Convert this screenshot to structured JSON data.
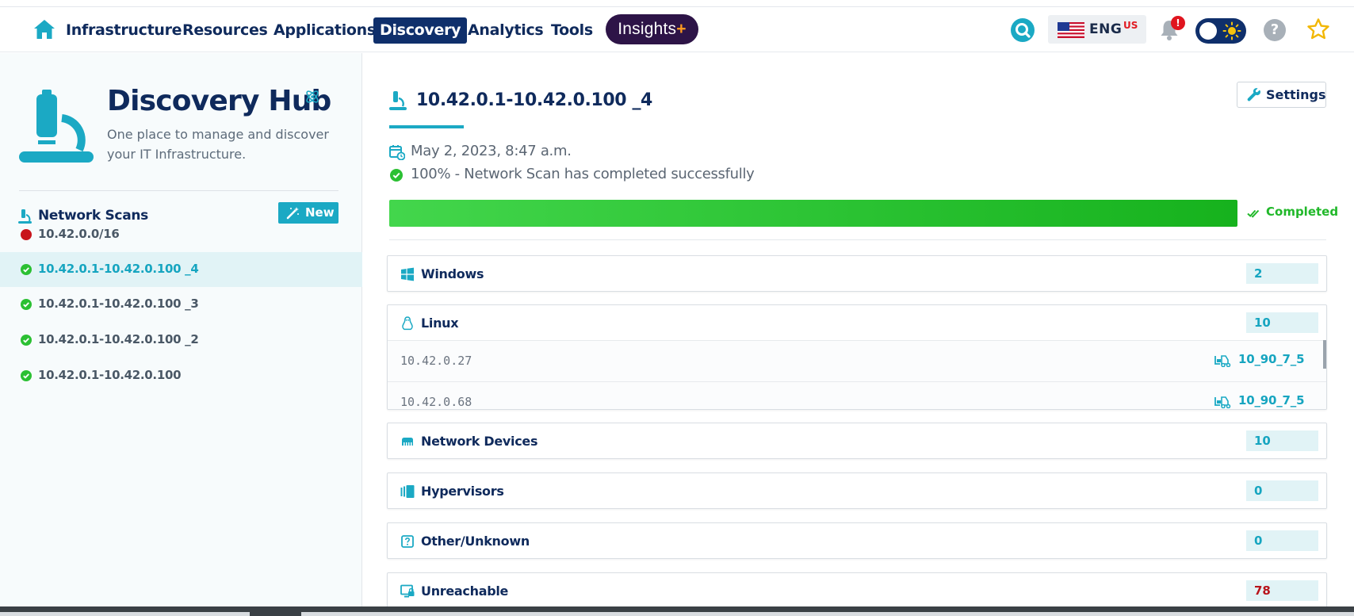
{
  "nav": {
    "items": [
      "Infrastructure",
      "Resources",
      "Applications",
      "Discovery",
      "Analytics",
      "Tools"
    ],
    "active": "Discovery",
    "insights_label": "Insights",
    "insights_plus": "+",
    "lang_code": "ENG",
    "lang_region": "US",
    "notification_badge": "!"
  },
  "sidebar": {
    "title": "Discovery Hub",
    "subtitle": "One place to manage and discover your IT Infrastructure.",
    "scans_header": "Network Scans",
    "new_label": "New",
    "scans": [
      {
        "label": "10.42.0.0/16",
        "status": "failed"
      },
      {
        "label": "10.42.0.1-10.42.0.100 _4",
        "status": "success",
        "active": true
      },
      {
        "label": "10.42.0.1-10.42.0.100 _3",
        "status": "success"
      },
      {
        "label": "10.42.0.1-10.42.0.100 _2",
        "status": "success"
      },
      {
        "label": "10.42.0.1-10.42.0.100",
        "status": "success"
      }
    ]
  },
  "main": {
    "title": "10.42.0.1-10.42.0.100 _4",
    "settings_label": "Settings",
    "date": "May 2, 2023, 8:47 a.m.",
    "status_text": "100% - Network Scan has completed successfully",
    "progress_percent": 100,
    "progress_status": "Completed",
    "categories": [
      {
        "name": "Windows",
        "count": "2"
      },
      {
        "name": "Linux",
        "count": "10",
        "hosts": [
          {
            "ip": "10.42.0.27",
            "tag": "10_90_7_5"
          },
          {
            "ip": "10.42.0.68",
            "tag": "10_90_7_5"
          }
        ]
      },
      {
        "name": "Network Devices",
        "count": "10"
      },
      {
        "name": "Hypervisors",
        "count": "0"
      },
      {
        "name": "Other/Unknown",
        "count": "0"
      },
      {
        "name": "Unreachable",
        "count": "78"
      }
    ]
  },
  "colors": {
    "navy": "#0f2a5c",
    "accent": "#1ba9c4",
    "success": "#21b82a",
    "danger": "#b8141b"
  }
}
